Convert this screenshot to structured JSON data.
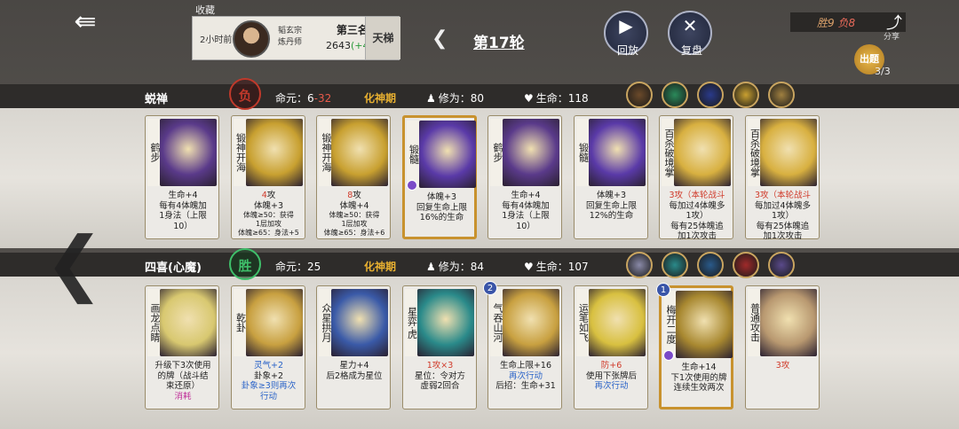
{
  "header": {
    "fav_label": "收藏",
    "record": {
      "time": "2小时前",
      "sect_line1": "韬玄宗",
      "sect_line2": "炼丹师",
      "rank": "第三名",
      "score": "2643",
      "score_delta": "(+49)",
      "ladder": "天梯"
    },
    "round": "第17轮",
    "replay_label": "回放",
    "review_label": "复盘",
    "win_label": "胜9",
    "lose_label": "负8",
    "share_label": "分享",
    "prop_label": "出题",
    "prop_count": "3/3"
  },
  "player1": {
    "name": "蜕禅",
    "result": "负",
    "life_label": "命元：",
    "life_value": "6",
    "life_delta": "-32",
    "realm": "化神期",
    "cultivation": "修为：80",
    "hp": "生命：118",
    "skill_colors": [
      "#6b4a2a",
      "#2a8a5a",
      "#2a3a8a",
      "#c9a030",
      "#a08040"
    ],
    "cards": [
      {
        "title": "鹤步",
        "lines": [
          {
            "t": "生命+4"
          },
          {
            "t": "每有4体魄加"
          },
          {
            "t": "1身法（上限"
          },
          {
            "t": "10）"
          }
        ],
        "art": "#5a3a8a",
        "gold": false
      },
      {
        "title": "锻神开海",
        "lines": [
          {
            "t": "4",
            "c": "r",
            "s": "攻"
          },
          {
            "t": "体魄+3"
          },
          {
            "t": "体魄≥50：获得",
            "small": true
          },
          {
            "t": "1层加攻",
            "small": true
          },
          {
            "t": "体魄≥65：身法+5",
            "small": true
          }
        ],
        "art": "#c8a030",
        "gold": false
      },
      {
        "title": "锻神开海",
        "lines": [
          {
            "t": "8",
            "c": "r",
            "s": "攻"
          },
          {
            "t": "体魄+4"
          },
          {
            "t": "体魄≥50：获得",
            "small": true
          },
          {
            "t": "1层加攻",
            "small": true
          },
          {
            "t": "体魄≥65：身法+6",
            "small": true
          }
        ],
        "art": "#c8a030",
        "gold": false
      },
      {
        "title": "锻髓",
        "lines": [
          {
            "t": "体魄+3"
          },
          {
            "t": "回复生命上限"
          },
          {
            "t": "16%的生命"
          }
        ],
        "art": "#5a3aa8",
        "gold": true
      },
      {
        "title": "鹤步",
        "lines": [
          {
            "t": "生命+4"
          },
          {
            "t": "每有4体魄加"
          },
          {
            "t": "1身法（上限"
          },
          {
            "t": "10）"
          }
        ],
        "art": "#5a3a8a",
        "gold": false
      },
      {
        "title": "锻髓",
        "lines": [
          {
            "t": "体魄+3"
          },
          {
            "t": "回复生命上限"
          },
          {
            "t": "12%的生命"
          }
        ],
        "art": "#5a3aa8",
        "gold": false
      },
      {
        "title": "百杀破境掌",
        "lines": [
          {
            "t": "3攻（本轮战斗",
            "c": "r2"
          },
          {
            "t": "每加过4体魄多"
          },
          {
            "t": "1攻）"
          },
          {
            "t": "每有25体魄追"
          },
          {
            "t": "加1次攻击"
          }
        ],
        "art": "#d8b040",
        "gold": false
      },
      {
        "title": "百杀破境掌",
        "lines": [
          {
            "t": "3攻（本轮战斗",
            "c": "r2"
          },
          {
            "t": "每加过4体魄多"
          },
          {
            "t": "1攻）"
          },
          {
            "t": "每有25体魄追"
          },
          {
            "t": "加1次攻击"
          }
        ],
        "art": "#d8b040",
        "gold": false
      }
    ]
  },
  "player2": {
    "name": "四喜(心魔)",
    "result": "胜",
    "life_label": "命元：",
    "life_value": "25",
    "realm": "化神期",
    "cultivation": "修为：84",
    "hp": "生命：107",
    "skill_colors": [
      "#8a8aa8",
      "#2a8a8a",
      "#2a5a8a",
      "#a02a2a",
      "#5a4a8a"
    ],
    "cards": [
      {
        "title": "画龙点睛",
        "lines": [
          {
            "t": "升级下3次使用"
          },
          {
            "t": "的牌（战斗结"
          },
          {
            "t": "束还原）"
          },
          {
            "t": "消耗",
            "c": "m"
          }
        ],
        "art": "#d8c870",
        "gold": false,
        "level": ""
      },
      {
        "title": "乾卦",
        "lines": [
          {
            "t": "灵气+2",
            "c": "b2"
          },
          {
            "t": "卦象+2"
          },
          {
            "t": "卦象≥3则再次",
            "c": "b3"
          },
          {
            "t": "行动",
            "c": "b"
          }
        ],
        "art": "#c8a040",
        "gold": false,
        "level": ""
      },
      {
        "title": "众星拱月",
        "lines": [
          {
            "t": "星力+4"
          },
          {
            "t": "后2格成为星位"
          }
        ],
        "art": "#3a5aa8",
        "gold": false,
        "level": ""
      },
      {
        "title": "星弈·虎",
        "lines": [
          {
            "t": "1攻×3",
            "c": "r2"
          },
          {
            "t": "星位：令对方"
          },
          {
            "t": "虚弱2回合"
          }
        ],
        "art": "#2a8a8a",
        "gold": false,
        "level": ""
      },
      {
        "title": "气吞山河",
        "lines": [
          {
            "t": "生命上限+16"
          },
          {
            "t": "再次行动",
            "c": "b"
          },
          {
            "t": "后招：生命+31"
          }
        ],
        "art": "#c8a040",
        "gold": false,
        "level": "2"
      },
      {
        "title": "运笔如飞",
        "lines": [
          {
            "t": "防+6",
            "c": "r3"
          },
          {
            "t": "使用下张牌后"
          },
          {
            "t": "再次行动",
            "c": "b"
          }
        ],
        "art": "#d8c040",
        "gold": false,
        "level": ""
      },
      {
        "title": "梅开二度",
        "lines": [
          {
            "t": "生命+14"
          },
          {
            "t": "下1次使用的牌"
          },
          {
            "t": "连续生效两次"
          }
        ],
        "art": "#a88830",
        "gold": true,
        "level": "1"
      },
      {
        "title": "普通攻击",
        "lines": [
          {
            "t": "3攻",
            "c": "r2"
          }
        ],
        "art": "#b89870",
        "gold": false,
        "level": ""
      }
    ]
  }
}
